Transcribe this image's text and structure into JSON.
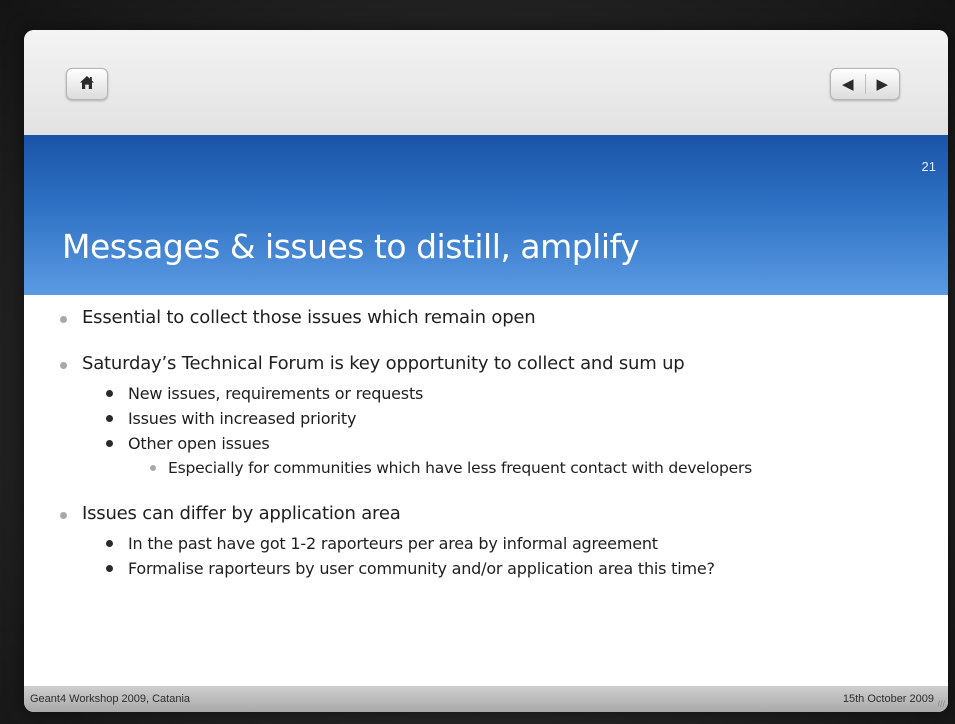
{
  "toolbar": {
    "home_icon": "home-icon",
    "prev_icon": "◀",
    "next_icon": "▶"
  },
  "slide": {
    "number": "21",
    "title": "Messages & issues to distill, amplify",
    "bullets": [
      {
        "text": "Essential to collect those issues which remain open"
      },
      {
        "text": "Saturday’s Technical Forum is key opportunity to collect and sum up",
        "sub": [
          "New issues, requirements or requests",
          "Issues with increased priority",
          "Other open issues"
        ],
        "subsub": "Especially for communities which have less frequent contact with developers"
      },
      {
        "text": "Issues can differ by application area",
        "sub": [
          "In the past have got 1-2 raporteurs per area by informal agreement",
          "Formalise raporteurs by user community and/or application area this time?"
        ]
      }
    ]
  },
  "footer": {
    "left": "Geant4 Workshop 2009, Catania",
    "right": "15th October 2009"
  }
}
